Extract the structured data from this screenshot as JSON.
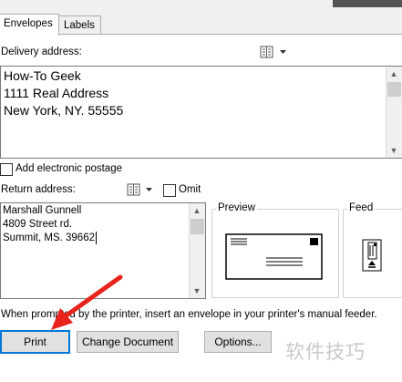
{
  "tabs": [
    {
      "label": "Envelopes"
    },
    {
      "label": "Labels"
    }
  ],
  "delivery": {
    "label": "Delivery address:",
    "text": "How-To Geek\n1111 Real Address\nNew York, NY. 55555"
  },
  "electronic_postage": {
    "label": "Add electronic postage"
  },
  "return": {
    "label": "Return address:",
    "omit_label": "Omit",
    "text": "Marshall Gunnell\n4809 Street rd.\nSummit, MS. 39662"
  },
  "preview": {
    "label": "Preview"
  },
  "feed": {
    "label": "Feed"
  },
  "instruction": "When prompted by the printer, insert an envelope in your printer's manual feeder.",
  "buttons": {
    "print": "Print",
    "change_document": "Change Document",
    "options": "Options..."
  },
  "watermark": "软件技巧",
  "colors": {
    "arrow": "#e8231b",
    "focus_border": "#0078d7"
  }
}
